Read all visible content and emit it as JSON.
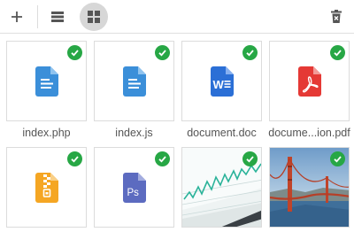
{
  "toolbar": {
    "add_icon": "plus-icon",
    "list_view_icon": "list-view-icon",
    "grid_view_icon": "grid-view-icon",
    "delete_icon": "delete-icon"
  },
  "files": [
    {
      "name": "index.php",
      "type": "document",
      "color": "#3b8fd9",
      "selected": true
    },
    {
      "name": "index.js",
      "type": "document",
      "color": "#3b8fd9",
      "selected": true
    },
    {
      "name": "document.doc",
      "type": "word",
      "color": "#2b6fd6",
      "selected": true
    },
    {
      "name": "docume...ion.pdf",
      "type": "pdf",
      "color": "#e53935",
      "selected": true
    },
    {
      "name": "",
      "type": "archive",
      "color": "#f5a623",
      "selected": true
    },
    {
      "name": "",
      "type": "photoshop",
      "color": "#5c6bc0",
      "selected": true
    },
    {
      "name": "",
      "type": "chart-photo",
      "selected": true
    },
    {
      "name": "",
      "type": "bridge-photo",
      "selected": true
    }
  ],
  "colors": {
    "check": "#27a745",
    "border": "#dcdcdc",
    "active_view_bg": "#d7d7d7"
  }
}
